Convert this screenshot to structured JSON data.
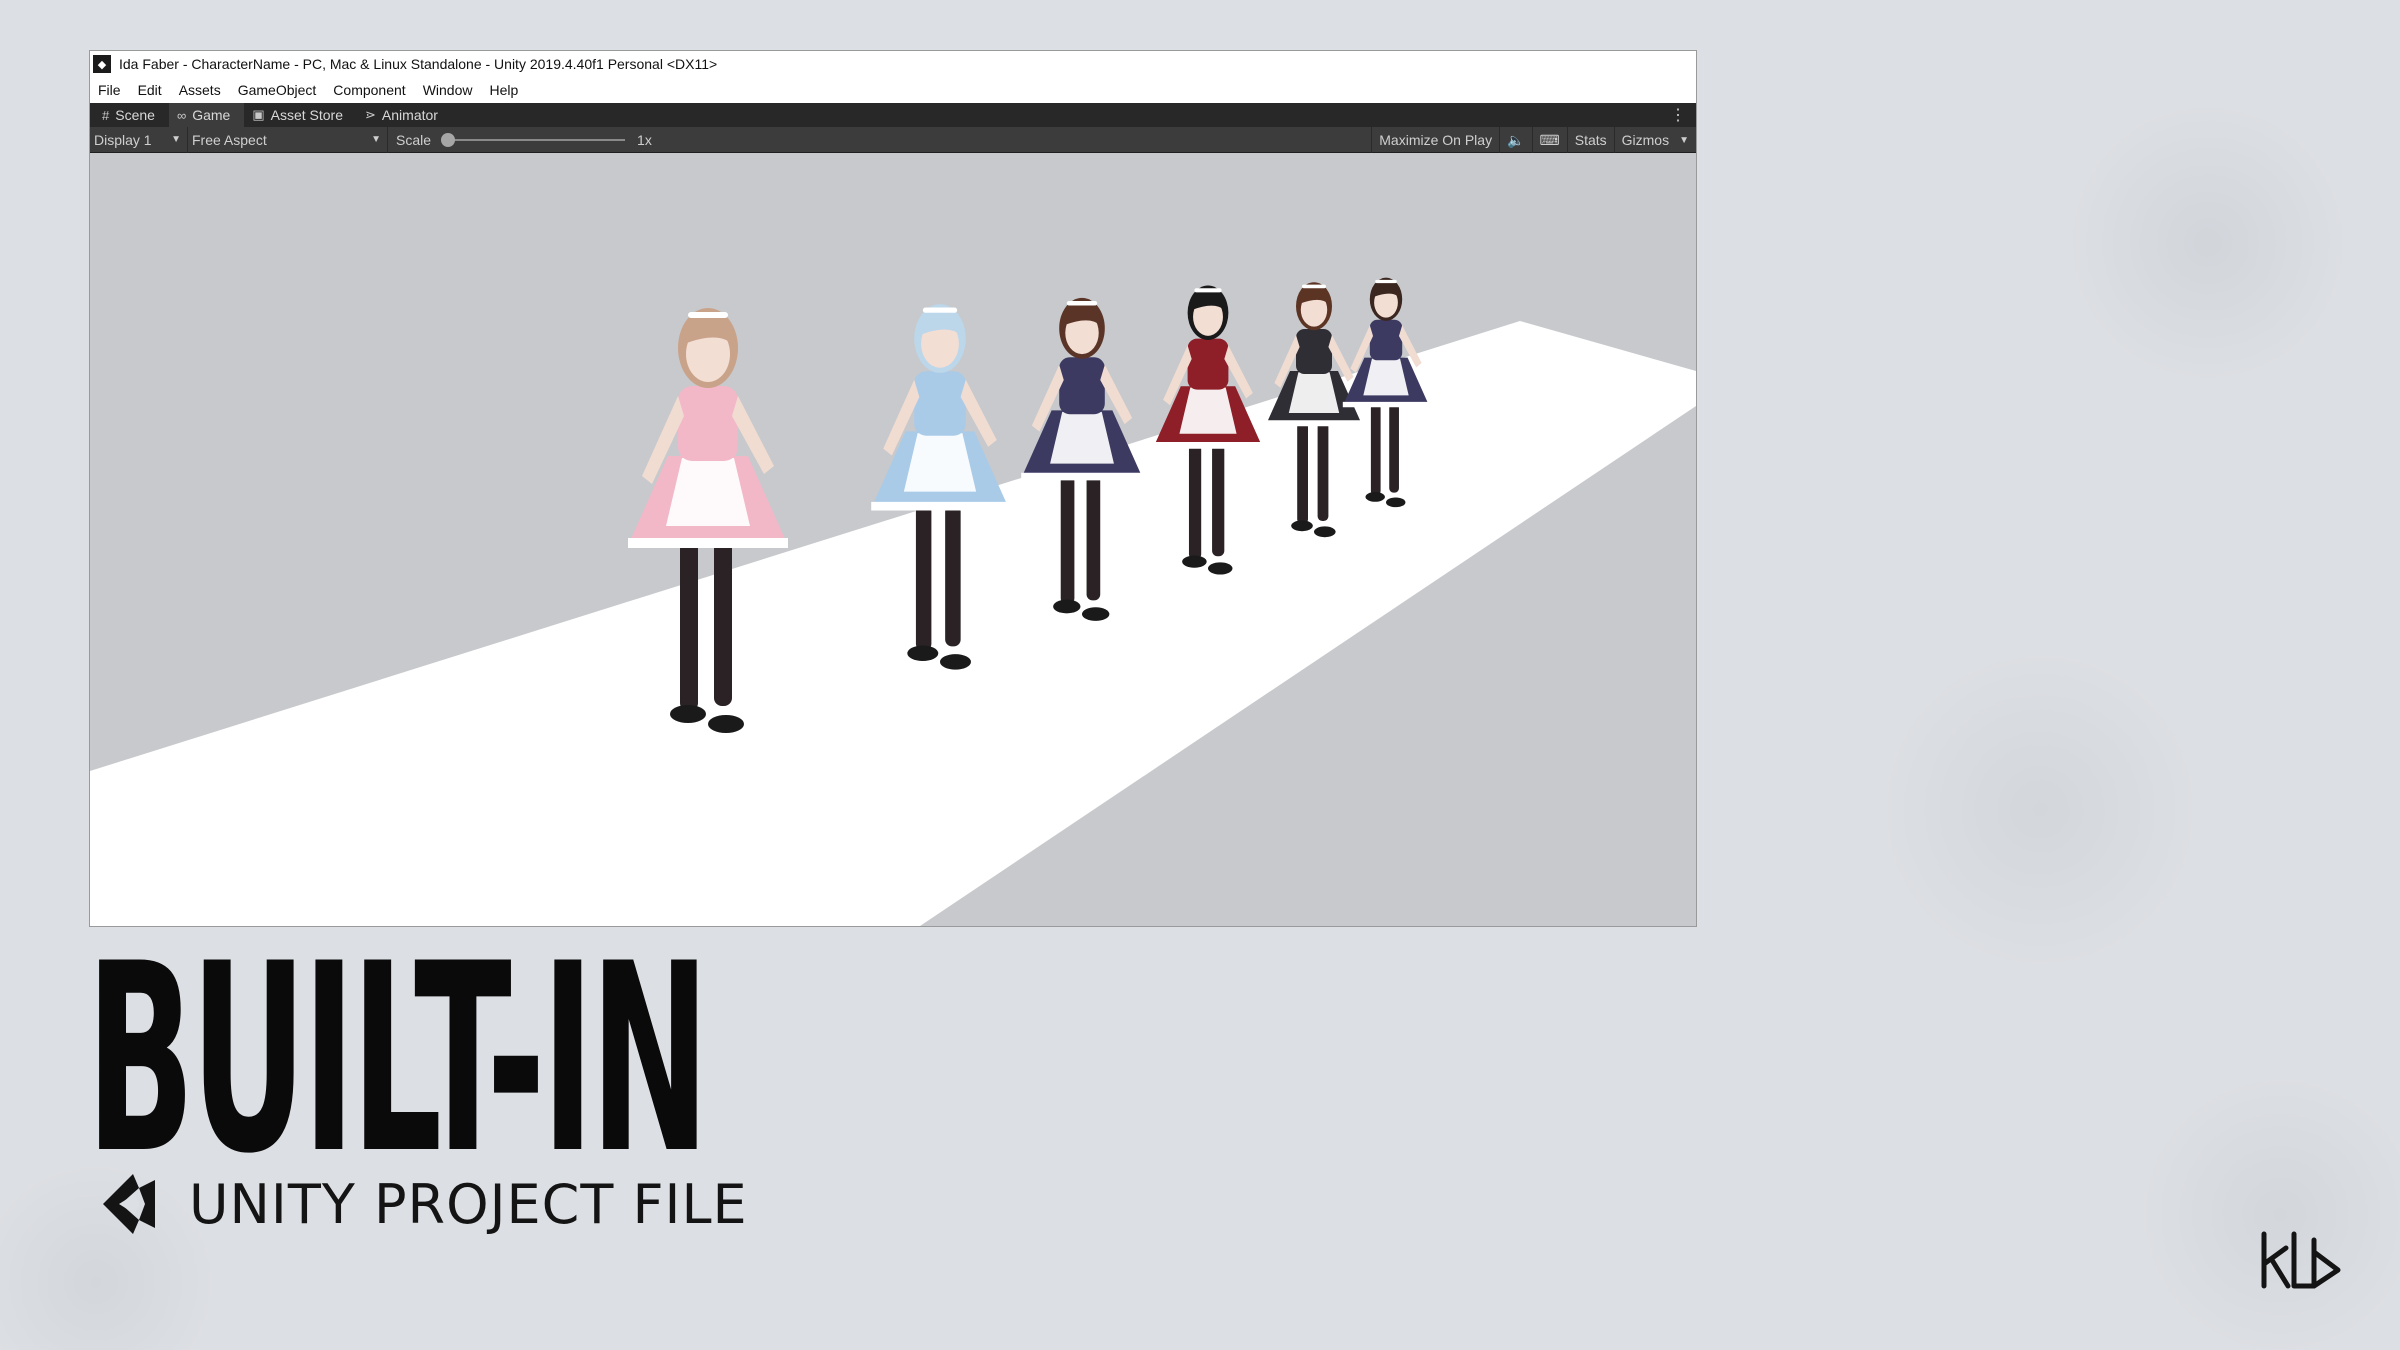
{
  "window": {
    "title": "Ida Faber - CharacterName - PC, Mac & Linux Standalone - Unity 2019.4.40f1 Personal <DX11>"
  },
  "menu": [
    "File",
    "Edit",
    "Assets",
    "GameObject",
    "Component",
    "Window",
    "Help"
  ],
  "tabs": [
    {
      "label": "Scene",
      "icon": "grid-icon"
    },
    {
      "label": "Game",
      "icon": "gamepad-icon"
    },
    {
      "label": "Asset Store",
      "icon": "bag-icon"
    },
    {
      "label": "Animator",
      "icon": "animator-icon"
    }
  ],
  "toolbar": {
    "display": "Display 1",
    "aspect": "Free Aspect",
    "scale_label": "Scale",
    "scale_value": "1x",
    "maximize": "Maximize On Play",
    "stats": "Stats",
    "gizmos": "Gizmos"
  },
  "headline": "BUILT-IN",
  "subtitle": "UNITY PROJECT FILE",
  "colors": {
    "background": "#dcdfe3",
    "unity_dark": "#282828",
    "toolbar": "#3c3c3c",
    "floor": "#ffffff",
    "scene_bg": "#c7c9cc"
  },
  "characters": [
    {
      "dress": "#f2b8c8",
      "hair": "#c9a28a"
    },
    {
      "dress": "#a9cbe8",
      "hair": "#bcd6ea"
    },
    {
      "dress": "#3d3a62",
      "hair": "#5a3426"
    },
    {
      "dress": "#8e1e28",
      "hair": "#1a1a1a"
    },
    {
      "dress": "#2e2e34",
      "hair": "#5c3424"
    },
    {
      "dress": "#3d3a62",
      "hair": "#3b2620"
    }
  ]
}
